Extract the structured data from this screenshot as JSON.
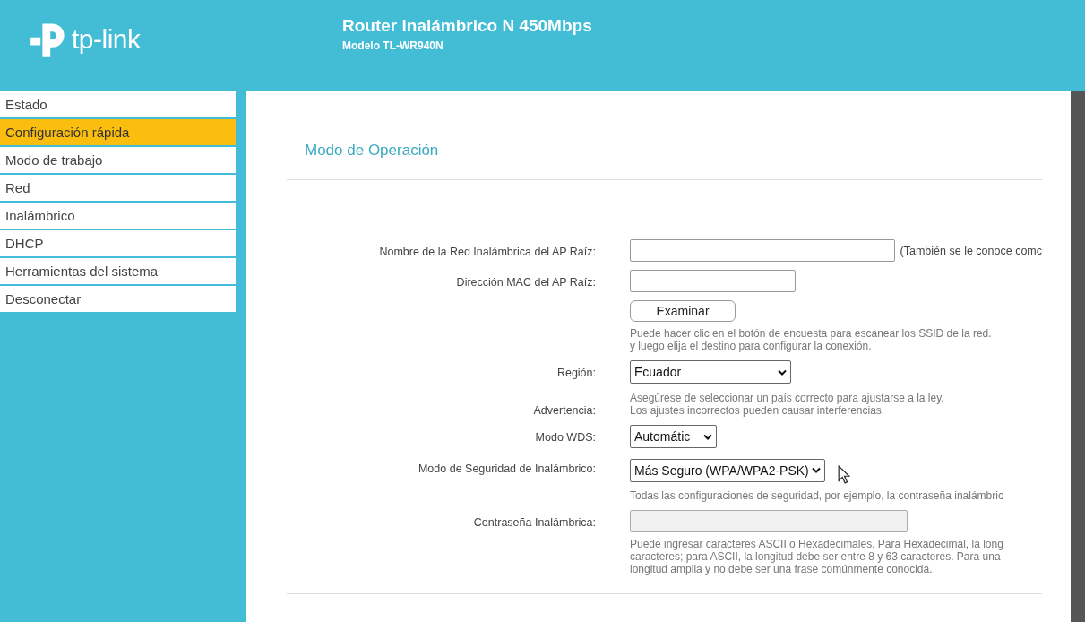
{
  "header": {
    "logo_text": "tp-link",
    "title": "Router inalámbrico N 450Mbps",
    "subtitle": "Modelo TL-WR940N"
  },
  "sidebar": {
    "items": [
      {
        "label": "Estado",
        "selected": false
      },
      {
        "label": "Configuración rápida",
        "selected": true
      },
      {
        "label": "Modo de trabajo",
        "selected": false
      },
      {
        "label": "Red",
        "selected": false
      },
      {
        "label": "Inalámbrico",
        "selected": false
      },
      {
        "label": "DHCP",
        "selected": false
      },
      {
        "label": "Herramientas del sistema",
        "selected": false
      },
      {
        "label": "Desconectar",
        "selected": false
      }
    ]
  },
  "page": {
    "title": "Modo de Operación",
    "rows": [
      {
        "kind": "input",
        "label": "Nombre de la Red Inalámbrica del AP Raíz:",
        "suffix": "(También se le conoce comc"
      },
      {
        "kind": "input",
        "label": "Dirección MAC del AP Raíz:"
      },
      {
        "kind": "button",
        "text": "Examinar",
        "note": [
          "Puede hacer clic en el botón de encuesta para escanear los SSID de la red.",
          "y luego elija el destino para configurar la conexión."
        ]
      },
      {
        "kind": "select",
        "label": "Región:",
        "value": "Ecuador"
      },
      {
        "kind": "note",
        "label": "Advertencia:",
        "note": [
          "Asegúrese de seleccionar un país correcto para ajustarse a la ley.",
          "Los ajustes incorrectos pueden causar interferencias."
        ]
      },
      {
        "kind": "select",
        "label": "Modo WDS:",
        "value": "Automátic"
      },
      {
        "kind": "select",
        "label": "Modo de Seguridad de Inalámbrico:",
        "value": "Más Seguro (WPA/WPA2-PSK)",
        "note": [
          "Todas las configuraciones de seguridad, por ejemplo, la contraseña inalámbric"
        ]
      },
      {
        "kind": "input",
        "label": "Contraseña Inalámbrica:",
        "disabled": true,
        "note": [
          "Puede ingresar caracteres ASCII o Hexadecimales. Para Hexadecimal, la long",
          "caracteres; para ASCII, la longitud debe ser entre 8 y 63 caracteres. Para una",
          "longitud amplia y no debe ser una frase comúnmente conocida."
        ]
      }
    ]
  }
}
